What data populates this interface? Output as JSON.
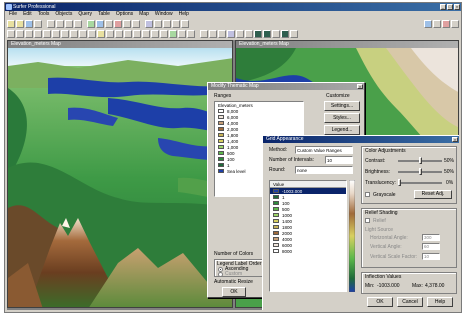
{
  "app": {
    "title": "Surfer Professional",
    "menus": [
      "File",
      "Edit",
      "Tools",
      "Objects",
      "Query",
      "Table",
      "Options",
      "Map",
      "Window",
      "Help"
    ]
  },
  "windows": {
    "left_map_title": "Elevation_meters Map",
    "right_map_title": "Elevation_meters Map"
  },
  "thematic_dialog": {
    "title": "Modify Thematic Map",
    "ranges_label": "Ranges",
    "layer_name": "Elevation_meters",
    "ranges": [
      {
        "label": "8,000",
        "color": "#ffffff"
      },
      {
        "label": "6,000",
        "color": "#f0e6dc"
      },
      {
        "label": "4,000",
        "color": "#c8a078"
      },
      {
        "label": "2,000",
        "color": "#a06a3a"
      },
      {
        "label": "1,800",
        "color": "#c8b458"
      },
      {
        "label": "1,400",
        "color": "#d8d060"
      },
      {
        "label": "1,000",
        "color": "#9ed66a"
      },
      {
        "label": "500",
        "color": "#5cb84a"
      },
      {
        "label": "100",
        "color": "#2e8a3c"
      },
      {
        "label": "1",
        "color": "#1e6a3a"
      },
      {
        "label": "Sea level",
        "color": "#1d3fa8"
      }
    ],
    "number_of_colors_label": "Number of Colors",
    "legend_label_order_label": "Legend Label Order",
    "ascending_label": "Ascending",
    "custom_label": "Custom",
    "automatic_resize_label": "Automatic Resize",
    "ok_label": "OK",
    "custom_group_label": "Customize",
    "settings_button": "Settings...",
    "styles_button": "Styles...",
    "legend_button": "Legend..."
  },
  "grid_dialog": {
    "title": "Grid Appearance",
    "method_label": "Method:",
    "method_value": "Custom Value Ranges",
    "intervals_label": "Number of Intervals:",
    "intervals_value": "10",
    "round_label": "Round:",
    "round_value": "none",
    "value_header": "Value",
    "values": [
      {
        "label": "-1003.000",
        "color": "#1d3fa8"
      },
      {
        "label": "1",
        "color": "#1e6a3a"
      },
      {
        "label": "100",
        "color": "#2e8a3c"
      },
      {
        "label": "500",
        "color": "#5cb84a"
      },
      {
        "label": "1000",
        "color": "#9ed66a"
      },
      {
        "label": "1400",
        "color": "#d8d060"
      },
      {
        "label": "1800",
        "color": "#c8b458"
      },
      {
        "label": "2000",
        "color": "#a06a3a"
      },
      {
        "label": "4000",
        "color": "#c8a078"
      },
      {
        "label": "6000",
        "color": "#f0e6dc"
      },
      {
        "label": "8000",
        "color": "#ffffff"
      }
    ],
    "color_adjust_label": "Color Adjustments",
    "contrast_label": "Contrast:",
    "contrast_value": "50%",
    "contrast_level": 0.5,
    "brightness_label": "Brightness:",
    "brightness_value": "50%",
    "brightness_level": 0.5,
    "translucency_label": "Translucency:",
    "translucency_value": "0%",
    "translucency_level": 0.0,
    "grayscale_label": "Grayscale",
    "reset_label": "Reset Adj.",
    "relief_label": "Relief Shading",
    "relief_check_label": "Relief",
    "light_source_label": "Light Source",
    "horizontal_angle_label": "Horizontal Angle:",
    "horizontal_angle_value": "300",
    "vertical_angle_label": "Vertical Angle:",
    "vertical_angle_value": "60",
    "vertical_scale_label": "Vertical Scale Factor:",
    "vertical_scale_value": "10",
    "inflection_label": "Inflection Values",
    "min_label": "Min:",
    "min_value": "-1003.000",
    "max_label": "Max:",
    "max_value": "4,378.00",
    "ok_label": "OK",
    "cancel_label": "Cancel",
    "help_label": "Help"
  }
}
